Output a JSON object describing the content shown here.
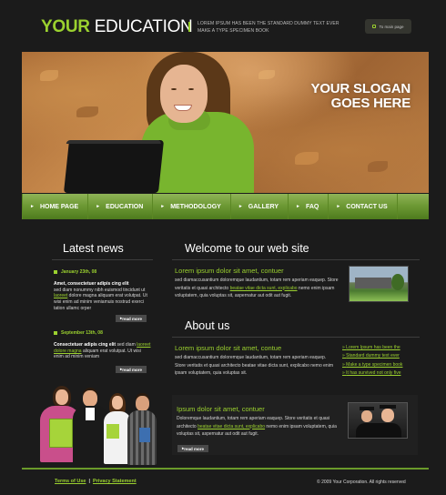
{
  "header": {
    "logo_part1": "YOUR",
    "logo_part2": "EDUCATION",
    "tagline": "LOREM IPSUM HAS BEEN THE STANDARD DUMMY TEXT EVER MAKE A TYPE SPECIMEN BOOK",
    "main_button": "To main page"
  },
  "hero": {
    "slogan_line1": "YOUR SLOGAN",
    "slogan_line2": "GOES HERE"
  },
  "nav": {
    "items": [
      "HOME PAGE",
      "EDUCATION",
      "METHODOLOGY",
      "GALLERY",
      "FAQ",
      "CONTACT US"
    ]
  },
  "sidebar": {
    "title": "Latest news",
    "news": [
      {
        "date": "January 23th, 08",
        "head": "Amet, consectetuer adipis cing elit",
        "text_pre": "sed diam nonummy nibh euismod tincidunt ut ",
        "link": "laoreet",
        "text_post": " dolore magna aliquam erat volutpat. Ut wisi enim ad minim veniamuis nostrud exerci tation ullamc orper",
        "readmore": "read more"
      },
      {
        "date": "September 13th, 08",
        "head": "Consectetuer adipis cing elit",
        "text_pre": " sed diam ",
        "link": "laoreet dolore magna",
        "text_post": " aliquam erat volutpat. Ut wisi enim ad minim veniam",
        "readmore": "read more"
      }
    ]
  },
  "welcome": {
    "title": "Welcome to our web site",
    "lede": "Lorem ipsum dolor sit amet, contuer",
    "text_pre": "sed diamaccusantium doloremque laudantium, totam rem aperiam eaquep. Store veritatis et quasi architecto ",
    "link": "beatae vitae dicta sunt, explicabo",
    "text_post": " nemo enim ipsam voluptatem, quia voluptas sit, aspernatur aut odit aut fugit."
  },
  "about": {
    "title": "About us",
    "lede": "Lorem ipsum dolor sit amet, contue",
    "text": "sed diamaccusantium doloremque laudantium, totam rem aperiam eaquep. Store veritatis et quasi architecto beatae vitae dicta sunt, explicabo nemo enim ipsam voluptatem, quia voluptas sit.",
    "links": [
      "Lorem Ipsum has been the",
      "Standard dummy text ever",
      "Make a type specimen book",
      "It has survived not only five"
    ]
  },
  "feature": {
    "lede": "Ipsum dolor sit amet, contuer",
    "text_pre": "Doloremque laudantium, totam rem aperiam eaquep. Store veritatis et quasi architecto ",
    "link": "beatae vitae dicta sunt, explicabo",
    "text_post": " nemo enim ipsam voluptatem, quia voluptas sit, aspernatur aut odit aut fugit.",
    "readmore": "read more"
  },
  "footer": {
    "terms": "Terms of Use",
    "privacy": "Privacy Statement",
    "separator": "|",
    "copyright": "© 2009 Your Corporation. All rights reserved"
  },
  "colors": {
    "accent": "#9bd12f",
    "background": "#1b1b1b",
    "nav": "#6e9a35"
  }
}
